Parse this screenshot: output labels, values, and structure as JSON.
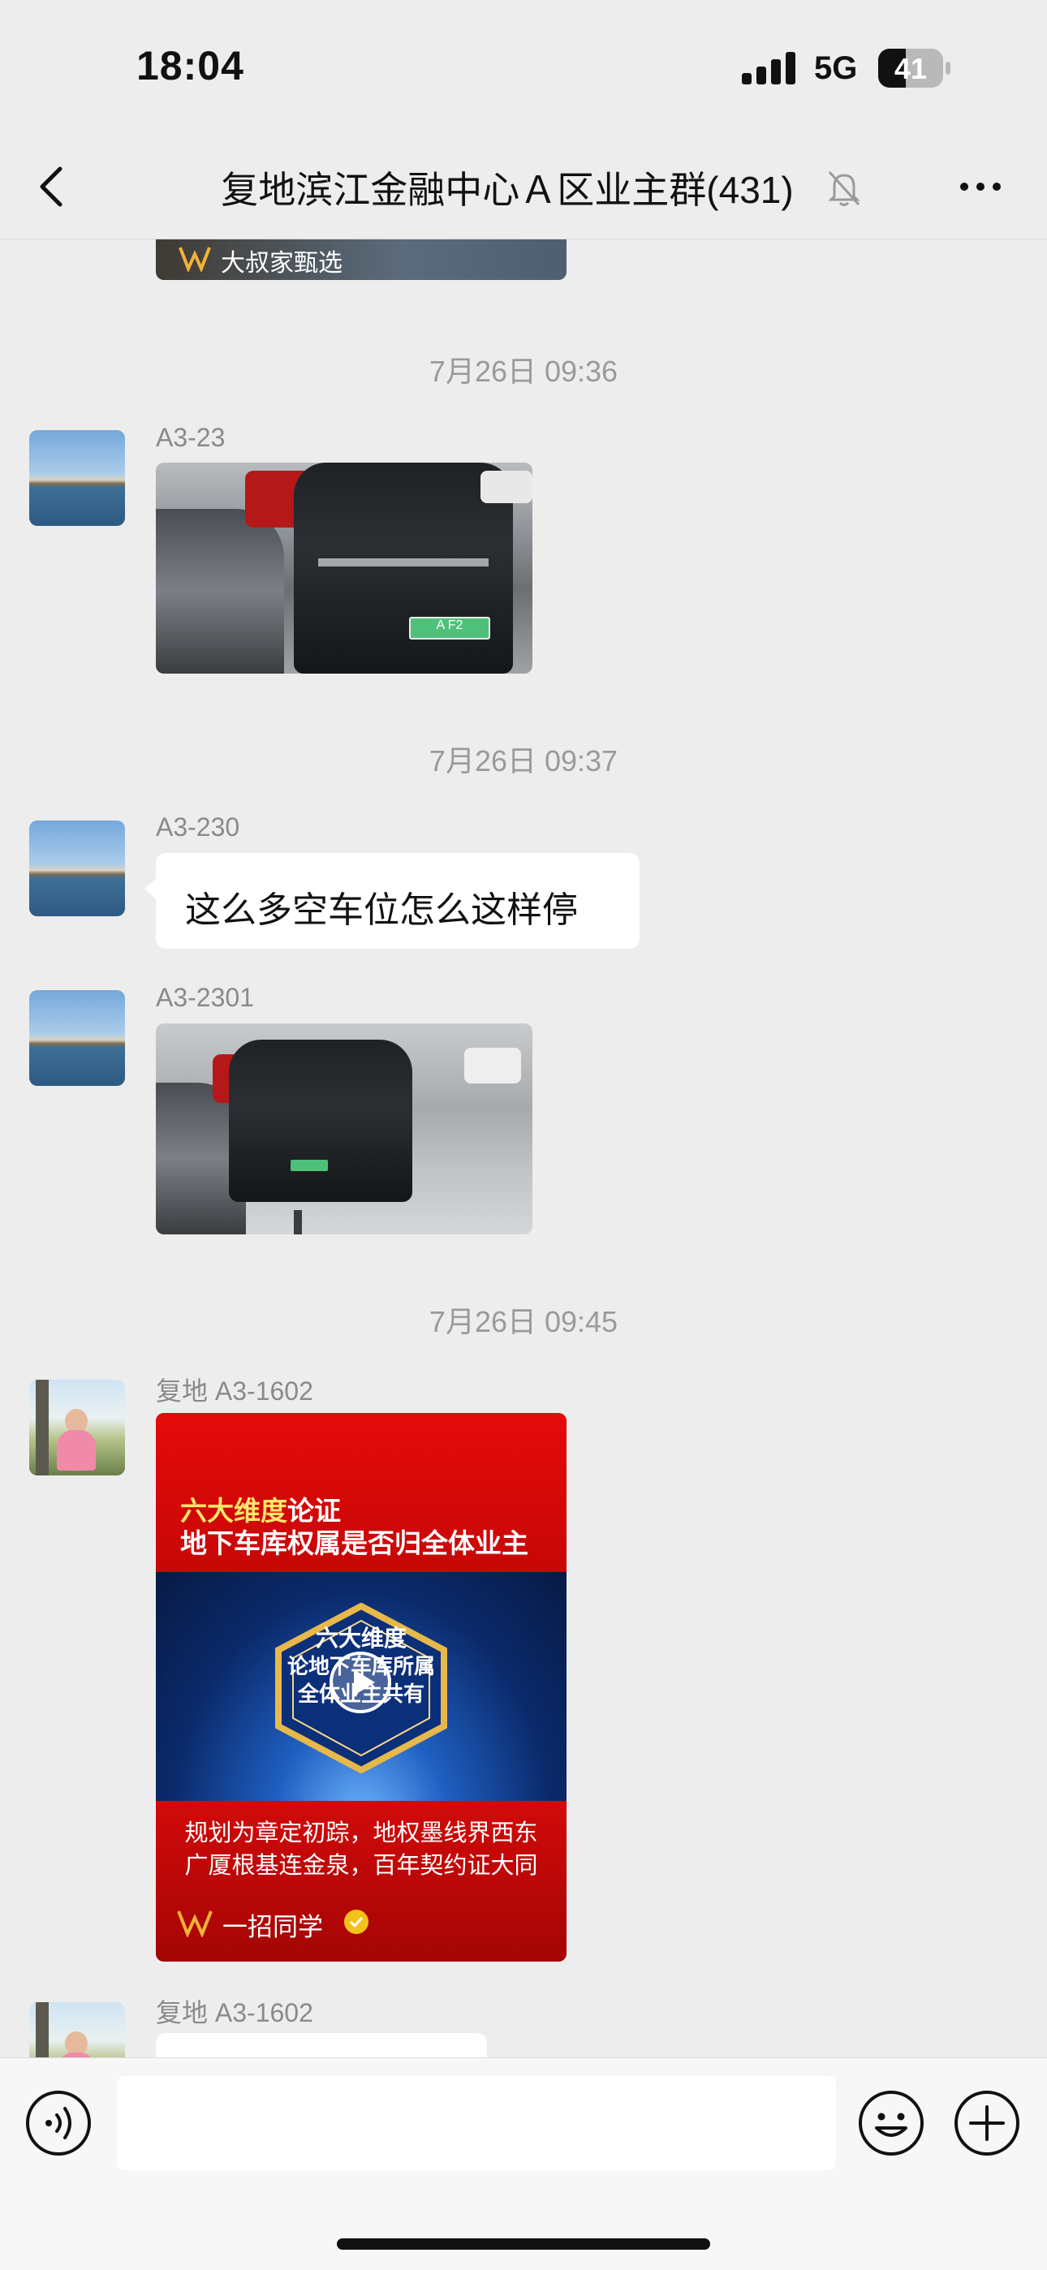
{
  "status_bar": {
    "time": "18:04",
    "network": "5G",
    "battery": "41"
  },
  "nav": {
    "title": "复地滨江金融中心Ａ区业主群(431)"
  },
  "top_partial": {
    "label": "大叔家甄选"
  },
  "messages": [
    {
      "time": "7月26日 09:36",
      "sender": "A3-23",
      "type": "image"
    },
    {
      "time": "7月26日 09:37",
      "sender": "A3-230",
      "type": "text",
      "text": "这么多空车位怎么这样停"
    },
    {
      "sender": "A3-2301",
      "type": "image"
    },
    {
      "time": "7月26日 09:45",
      "sender": "复地 A3-1602",
      "type": "video"
    },
    {
      "sender": "复地 A3-1602",
      "type": "text",
      "text": ""
    }
  ],
  "photo1": {
    "plate": "A F2"
  },
  "video": {
    "title_highlight": "六大维度",
    "title_rest": "论证",
    "title_line2": "地下车库权属是否归全体业主",
    "hex_line1": "六大维度",
    "hex_line2": "论地下车库所属",
    "hex_line3": "全体业主共有",
    "caption_line1": "规划为章定初踪，地权墨线界西东",
    "caption_line2": "广厦根基连金泉，百年契约证大同",
    "channel": "一招同学"
  },
  "icons": {
    "back": "chevron-left-icon",
    "mute": "bell-slash-icon",
    "more": "more-dots-icon",
    "voice": "voice-icon",
    "emoji": "emoji-icon",
    "plus": "plus-icon"
  },
  "colors": {
    "background": "#ededed",
    "bubble": "#ffffff",
    "video_red": "#d20a0a",
    "highlight": "#ffe56a"
  }
}
